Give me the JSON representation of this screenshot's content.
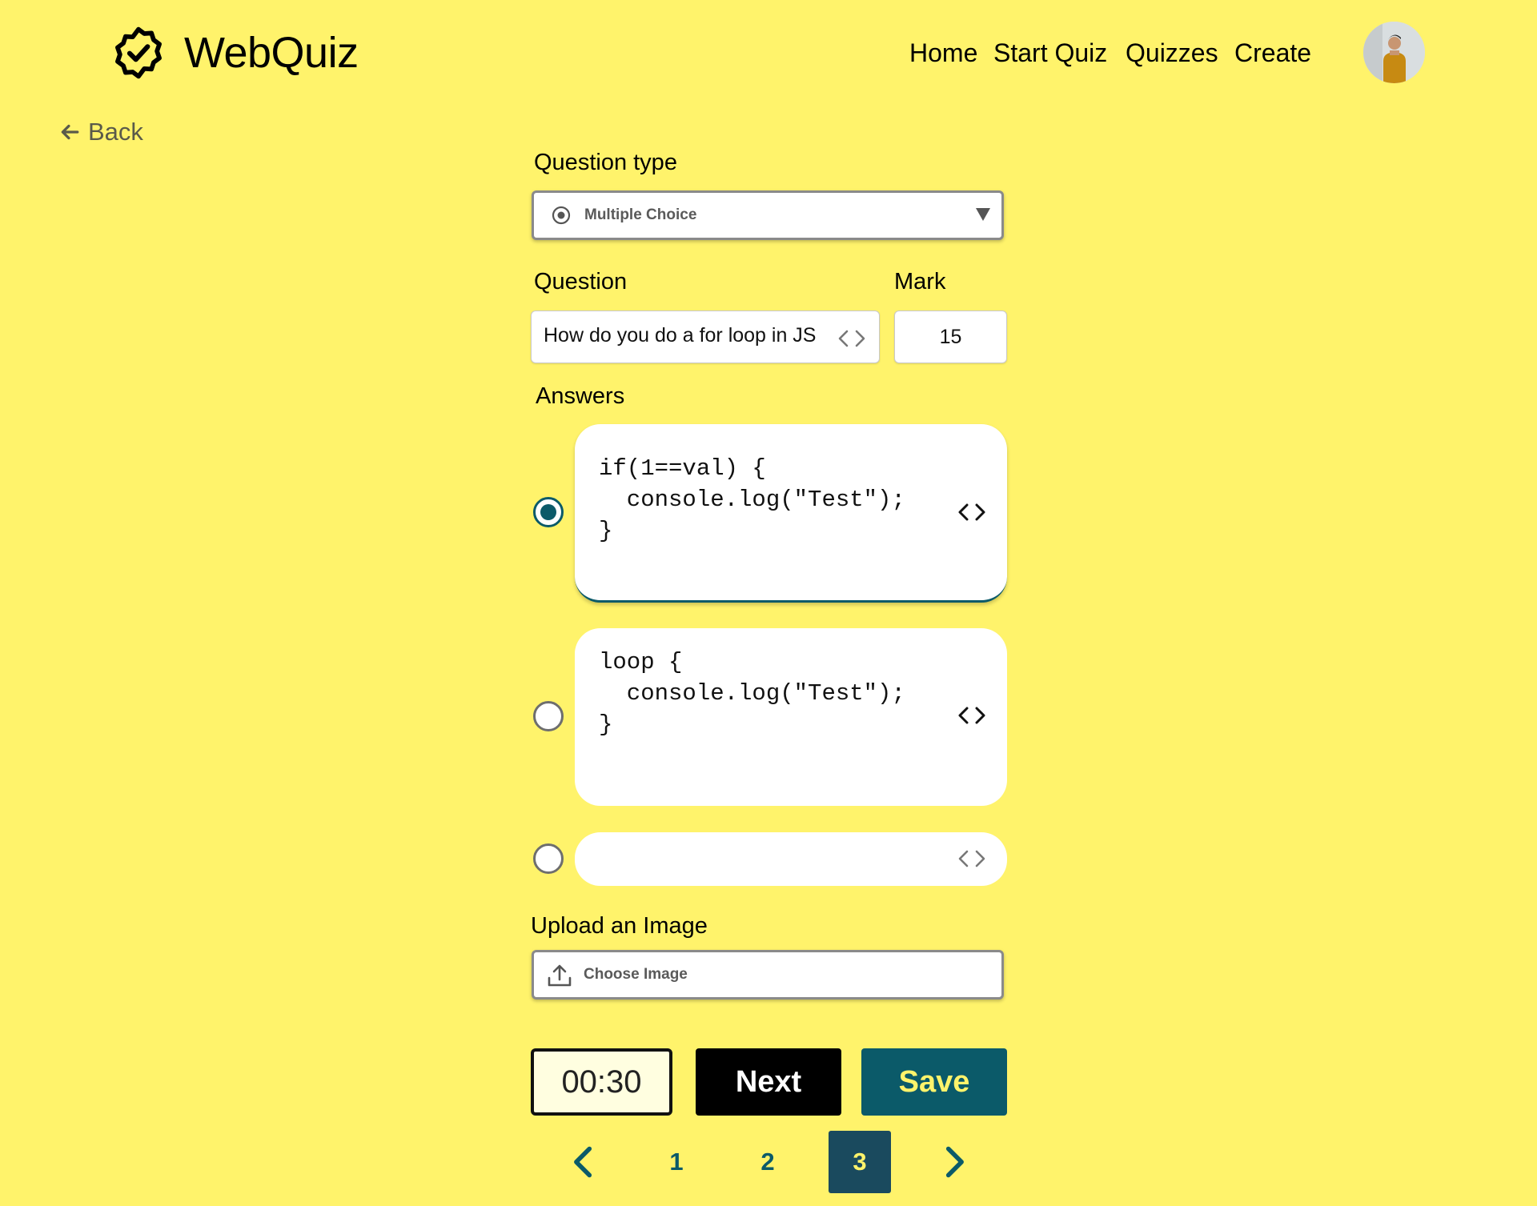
{
  "header": {
    "brand": "WebQuiz",
    "nav": [
      "Home",
      "Start Quiz",
      "Quizzes",
      "Create"
    ]
  },
  "back_label": "Back",
  "form": {
    "question_type_label": "Question type",
    "question_type_value": "Multiple Choice",
    "question_label": "Question",
    "question_value": "How do you do a for loop in JS",
    "mark_label": "Mark",
    "mark_value": "15",
    "answers_label": "Answers",
    "answers": [
      {
        "code": "if(1==val) {\n  console.log(\"Test\");\n}",
        "selected": true
      },
      {
        "code": "loop {\n  console.log(\"Test\");\n}",
        "selected": false
      },
      {
        "code": "",
        "selected": false
      }
    ],
    "upload_label": "Upload an Image",
    "upload_placeholder": "Choose Image"
  },
  "controls": {
    "timer": "00:30",
    "next_label": "Next",
    "save_label": "Save"
  },
  "pagination": {
    "pages": [
      "1",
      "2",
      "3"
    ],
    "current": "3"
  },
  "colors": {
    "background": "#FFF36B",
    "accent": "#0b5a69",
    "active_page": "#1a4a5e"
  }
}
